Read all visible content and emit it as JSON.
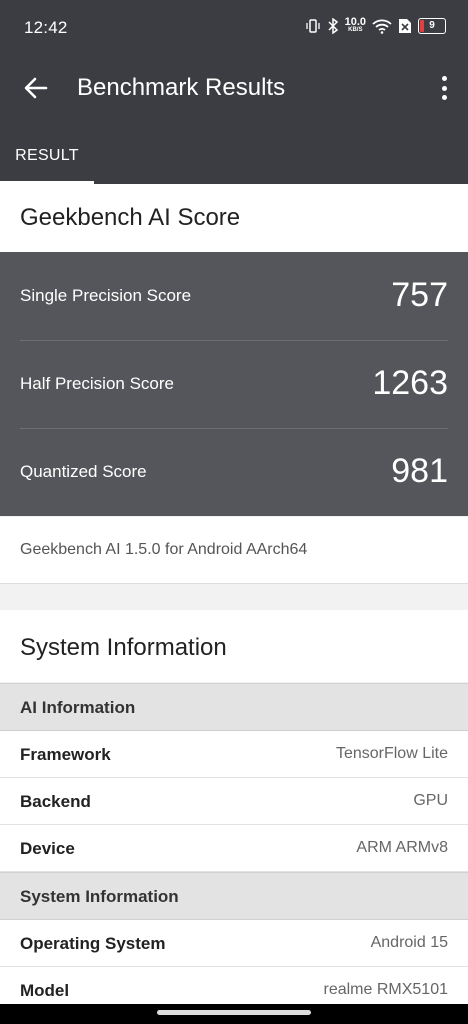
{
  "status_bar": {
    "time": "12:42",
    "speed_value": "10.0",
    "speed_unit": "KB/S",
    "battery_level": "9",
    "icons": [
      "vibrate-icon",
      "bluetooth-icon",
      "wifi-icon",
      "no-sim-icon",
      "battery-icon"
    ]
  },
  "app_bar": {
    "title": "Benchmark Results",
    "back_icon": "arrow-left-icon",
    "menu_icon": "more-vertical-icon"
  },
  "tabs": [
    {
      "label": "RESULT",
      "selected": true
    }
  ],
  "score_section": {
    "title": "Geekbench AI Score",
    "scores": [
      {
        "label": "Single Precision Score",
        "value": "757"
      },
      {
        "label": "Half Precision Score",
        "value": "1263"
      },
      {
        "label": "Quantized Score",
        "value": "981"
      }
    ],
    "version_text": "Geekbench AI 1.5.0 for Android AArch64"
  },
  "system_section": {
    "title": "System Information",
    "groups": [
      {
        "header": "AI Information",
        "rows": [
          {
            "key": "Framework",
            "value": "TensorFlow Lite"
          },
          {
            "key": "Backend",
            "value": "GPU"
          },
          {
            "key": "Device",
            "value": "ARM ARMv8"
          }
        ]
      },
      {
        "header": "System Information",
        "rows": [
          {
            "key": "Operating System",
            "value": "Android 15"
          },
          {
            "key": "Model",
            "value": "realme RMX5101"
          }
        ]
      }
    ]
  },
  "colors": {
    "header_bg": "#3c3d42",
    "score_bg": "#55565b",
    "page_bg": "#f2f2f2"
  }
}
